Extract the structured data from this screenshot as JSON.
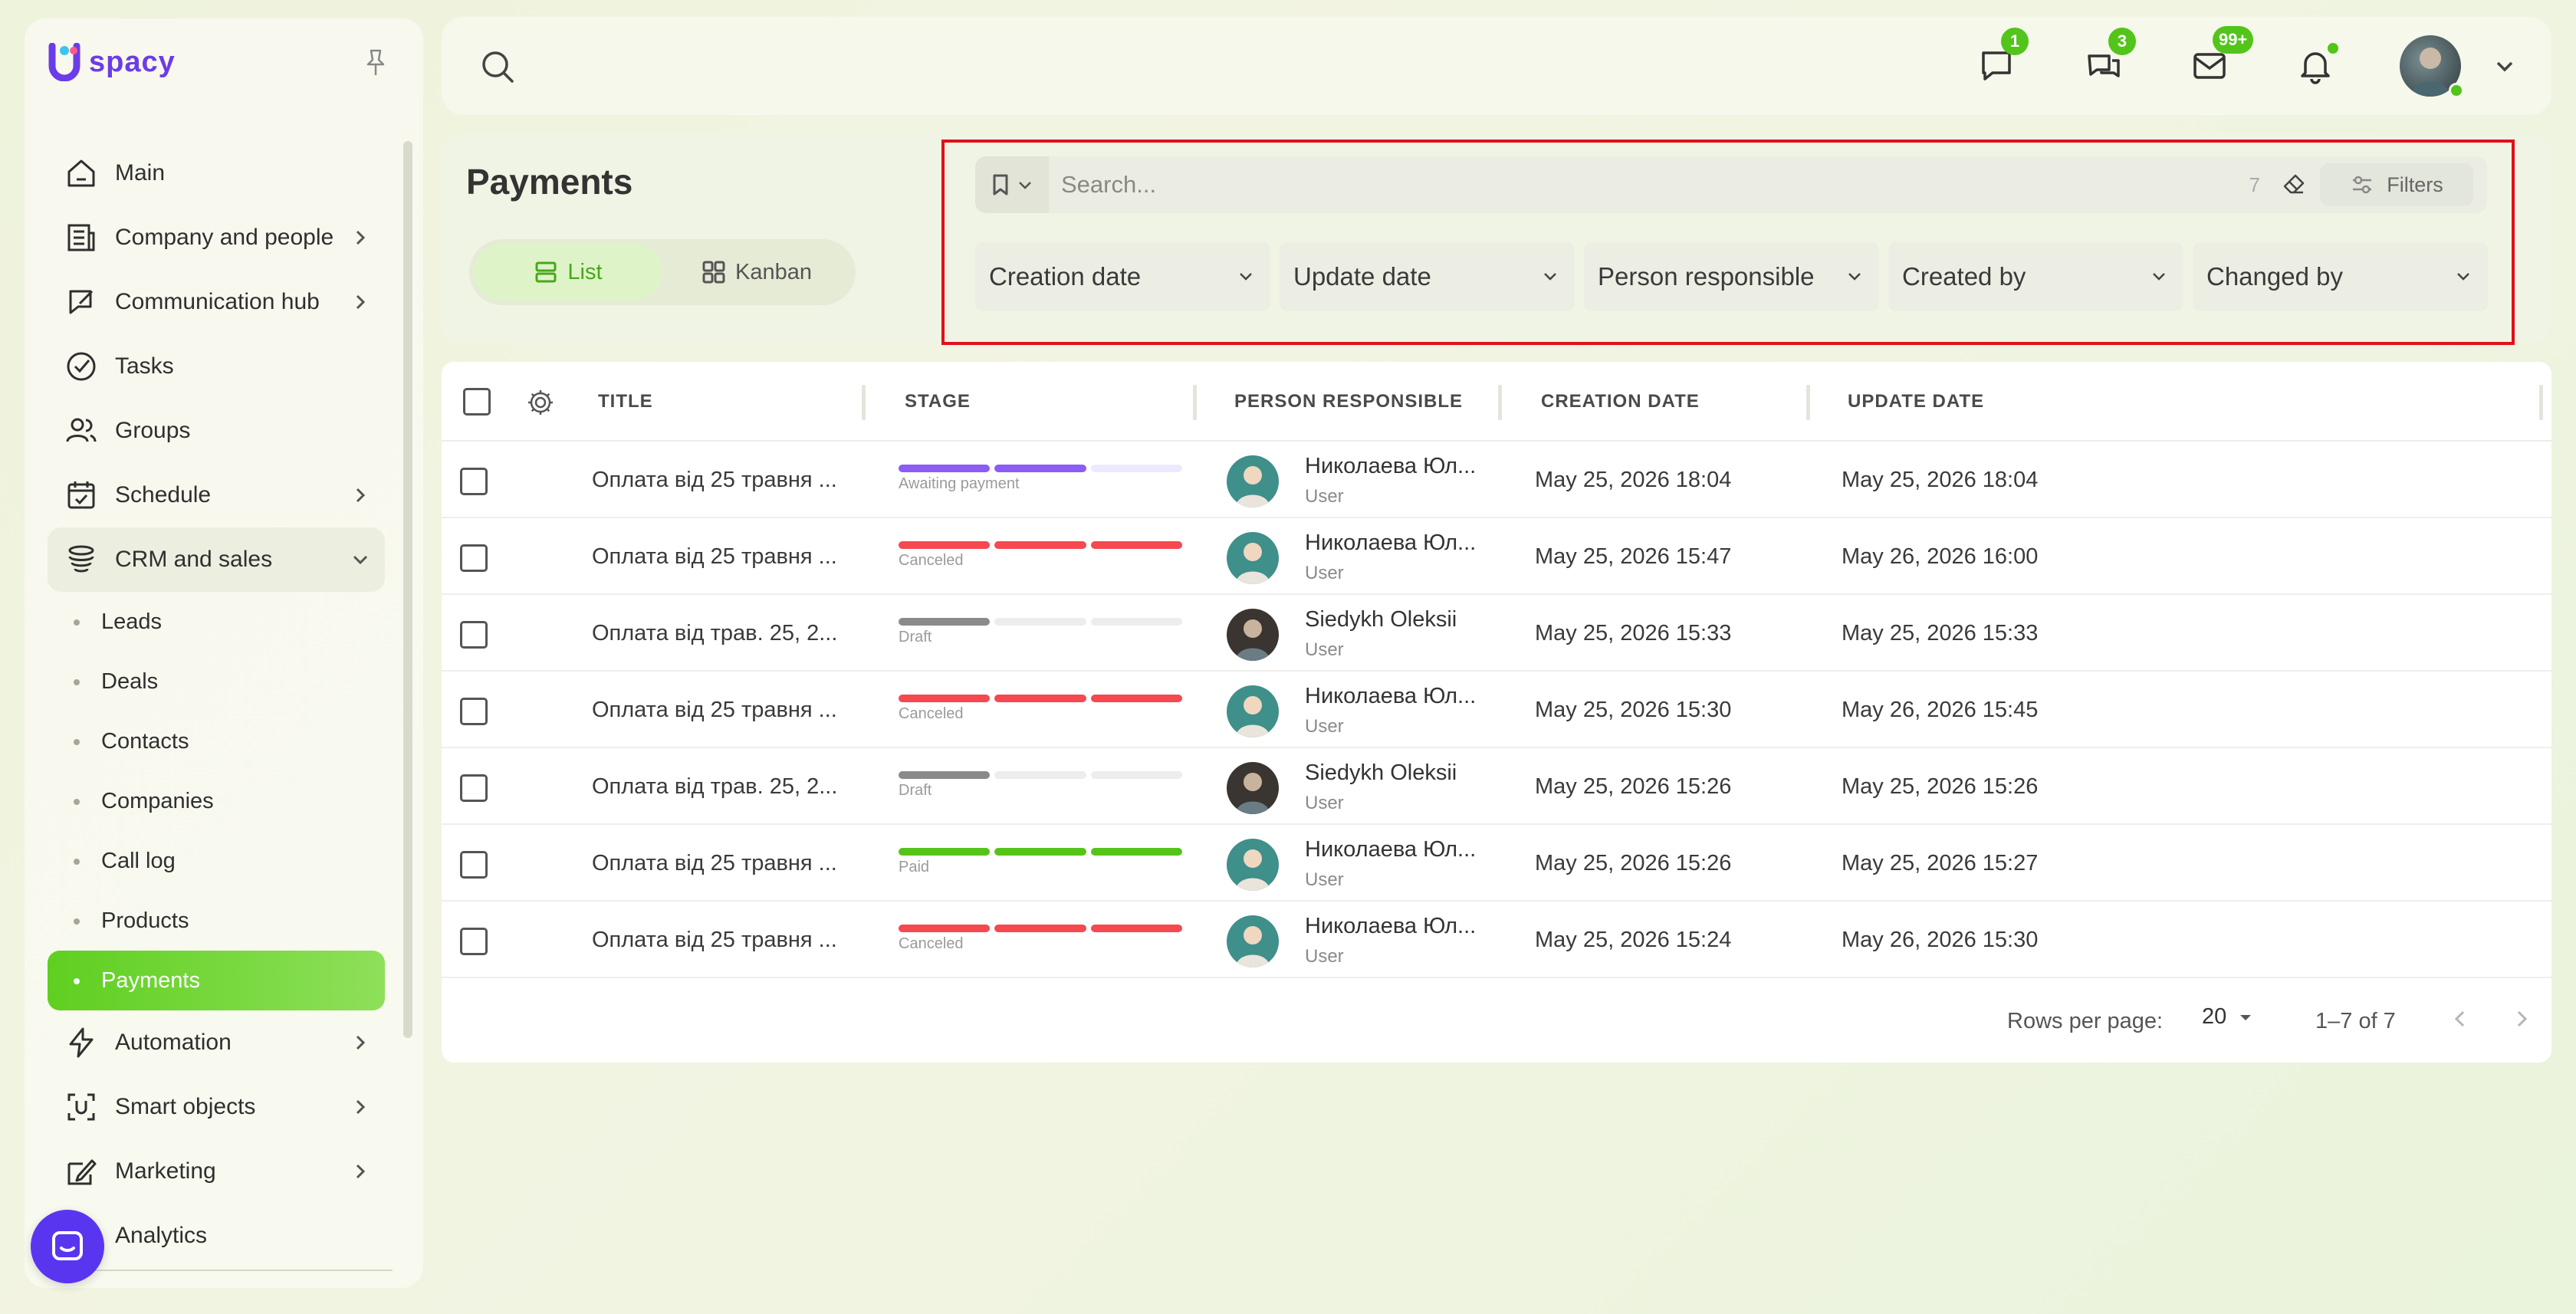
{
  "app": {
    "logo_text": "spacy"
  },
  "sidebar": {
    "items": [
      {
        "label": "Main"
      },
      {
        "label": "Company and people"
      },
      {
        "label": "Communication hub"
      },
      {
        "label": "Tasks"
      },
      {
        "label": "Groups"
      },
      {
        "label": "Schedule"
      },
      {
        "label": "CRM and sales"
      },
      {
        "label": "Automation"
      },
      {
        "label": "Smart objects"
      },
      {
        "label": "Marketing"
      },
      {
        "label": "Analytics"
      }
    ],
    "crm_sub": [
      {
        "label": "Leads"
      },
      {
        "label": "Deals"
      },
      {
        "label": "Contacts"
      },
      {
        "label": "Companies"
      },
      {
        "label": "Call log"
      },
      {
        "label": "Products"
      },
      {
        "label": "Payments"
      }
    ]
  },
  "topbar": {
    "chat_badge": "1",
    "comments_badge": "3",
    "mail_badge": "99+"
  },
  "header": {
    "title": "Payments",
    "view_list": "List",
    "view_kanban": "Kanban",
    "search_placeholder": "Search...",
    "search_count": "7",
    "filters_label": "Filters",
    "dropdowns": [
      "Creation date",
      "Update date",
      "Person responsible",
      "Created by",
      "Changed by"
    ]
  },
  "table": {
    "columns": [
      "TITLE",
      "STAGE",
      "PERSON RESPONSIBLE",
      "CREATION DATE",
      "UPDATE DATE"
    ],
    "rows": [
      {
        "title": "Оплата від 25 травня ...",
        "stage": "Awaiting payment",
        "person": "Николаева Юл...",
        "role": "User",
        "created": "May 25, 2026 18:04",
        "updated": "May 25, 2026 18:04"
      },
      {
        "title": "Оплата від 25 травня ...",
        "stage": "Canceled",
        "person": "Николаева Юл...",
        "role": "User",
        "created": "May 25, 2026 15:47",
        "updated": "May 26, 2026 16:00"
      },
      {
        "title": "Оплата від трав. 25, 2...",
        "stage": "Draft",
        "person": "Siedykh Oleksii",
        "role": "User",
        "created": "May 25, 2026 15:33",
        "updated": "May 25, 2026 15:33"
      },
      {
        "title": "Оплата від 25 травня ...",
        "stage": "Canceled",
        "person": "Николаева Юл...",
        "role": "User",
        "created": "May 25, 2026 15:30",
        "updated": "May 26, 2026 15:45"
      },
      {
        "title": "Оплата від трав. 25, 2...",
        "stage": "Draft",
        "person": "Siedykh Oleksii",
        "role": "User",
        "created": "May 25, 2026 15:26",
        "updated": "May 25, 2026 15:26"
      },
      {
        "title": "Оплата від 25 травня ...",
        "stage": "Paid",
        "person": "Николаева Юл...",
        "role": "User",
        "created": "May 25, 2026 15:26",
        "updated": "May 25, 2026 15:27"
      },
      {
        "title": "Оплата від 25 травня ...",
        "stage": "Canceled",
        "person": "Николаева Юл...",
        "role": "User",
        "created": "May 25, 2026 15:24",
        "updated": "May 26, 2026 15:30"
      }
    ],
    "rows_per_page_label": "Rows per page:",
    "rows_per_page_value": "20",
    "pagination": "1–7 of 7"
  },
  "colors": {
    "accent": "#5fcf20",
    "awaiting": "#8b5cf6",
    "canceled": "#f5484f",
    "draft": "#8a8a8a",
    "paid": "#55c41a",
    "highlight_border": "#e0101a"
  }
}
